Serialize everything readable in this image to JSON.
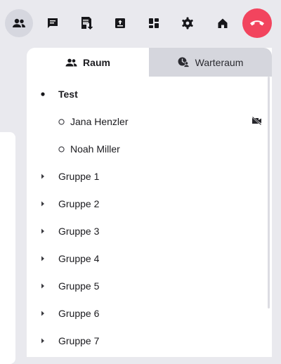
{
  "toolbar": {
    "buttons": [
      {
        "name": "participants-button",
        "icon": "participants-icon",
        "active": true
      },
      {
        "name": "chat-button",
        "icon": "chat-icon"
      },
      {
        "name": "files-button",
        "icon": "files-download-icon"
      },
      {
        "name": "upload-button",
        "icon": "upload-box-icon"
      },
      {
        "name": "layout-button",
        "icon": "dashboard-icon"
      },
      {
        "name": "settings-button",
        "icon": "gear-icon"
      },
      {
        "name": "home-button",
        "icon": "home-icon"
      },
      {
        "name": "hangup-button",
        "icon": "phone-hangup-icon",
        "color": "#f2445e"
      }
    ]
  },
  "tabs": {
    "raum": "Raum",
    "warteraum": "Warteraum",
    "active": "Raum"
  },
  "tree": {
    "room": {
      "label": "Test",
      "expanded": true
    },
    "users": [
      {
        "label": "Jana Henzler",
        "video_off": true
      },
      {
        "label": "Noah Miller",
        "video_off": false
      }
    ],
    "groups": [
      "Gruppe 1",
      "Gruppe 2",
      "Gruppe 3",
      "Gruppe 4",
      "Gruppe 5",
      "Gruppe 6",
      "Gruppe 7"
    ]
  },
  "colors": {
    "background": "#e9e9ee",
    "active_toolbar_bg": "#d6d7df",
    "hangup": "#f2445e",
    "inactive_tab": "#d5d6dd"
  }
}
